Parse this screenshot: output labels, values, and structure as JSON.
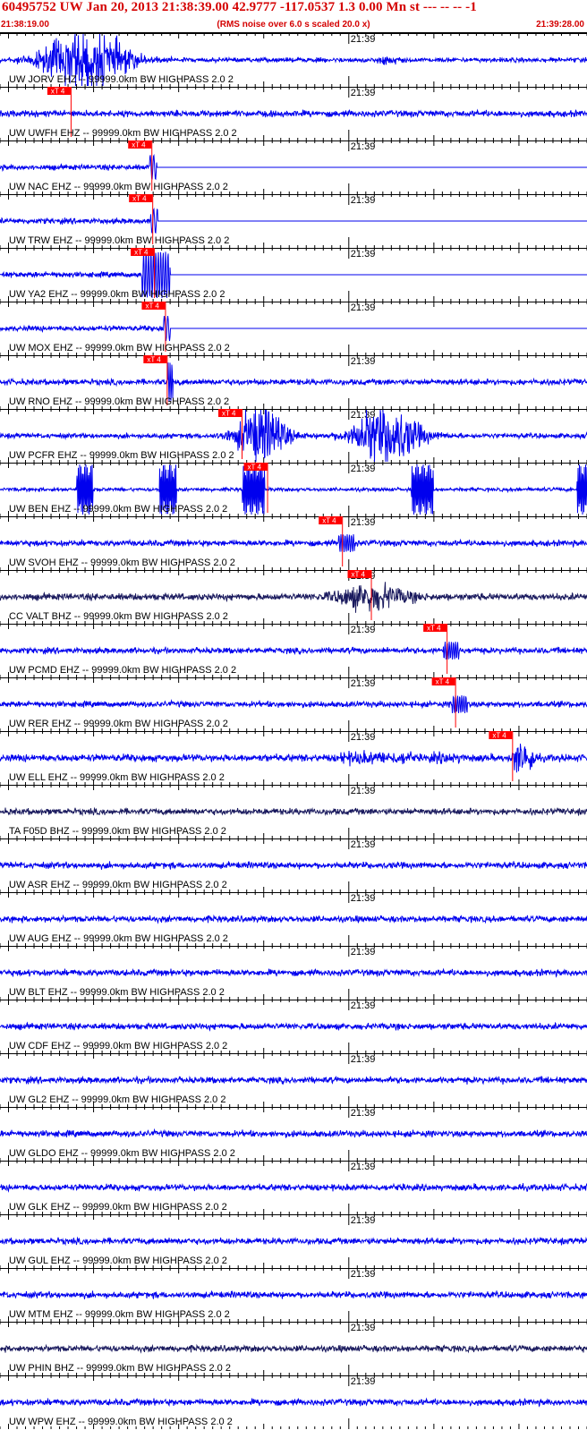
{
  "header": {
    "title": "60495752 UW Jan 20, 2013 21:38:39.00   42.9777 -117.0537  1.3 0.00 Mn st --- -- --  -1",
    "start_time": "21:38:19.00",
    "end_time": "21:39:28.00",
    "subtitle": "(RMS noise over 6.0 s scaled 20.0 x)"
  },
  "colors": {
    "trace": "#0000ee",
    "trace_dark": "#1a1a5e",
    "pick": "#ff0000",
    "title": "#d40000",
    "axis": "#000000"
  },
  "chart_data": {
    "type": "line",
    "title": "60495752 UW Jan 20, 2013 21:38:39.00   42.9777 -117.0537  1.3 0.00 Mn st --- -- --  -1",
    "xlabel": "",
    "ylabel": "",
    "time_range": [
      "21:38:19.00",
      "21:39:28.00"
    ],
    "minute_tick_label": "21:39",
    "minute_tick_time": "21:39:00",
    "grid": false,
    "traces": [
      {
        "label": "UW JORV EHZ -- 99999.0km BW  HIGHPASS  2.0  2",
        "pick": "",
        "pick_time": null,
        "shape": "early_burst",
        "color": "trace"
      },
      {
        "label": "UW UWFH EHZ -- 99999.0km BW  HIGHPASS  2.0  2",
        "pick": "xT 4",
        "pick_time": "21:38:27.3",
        "shape": "noise",
        "color": "trace"
      },
      {
        "label": "UW NAC EHZ -- 99999.0km BW  HIGHPASS  2.0  2",
        "pick": "xT 4",
        "pick_time": "21:38:36.8",
        "shape": "flat_after",
        "color": "trace"
      },
      {
        "label": "UW TRW EHZ -- 99999.0km BW  HIGHPASS  2.0  2",
        "pick": "xT 4",
        "pick_time": "21:38:36.9",
        "shape": "flat_after",
        "color": "trace"
      },
      {
        "label": "UW YA2 EHZ -- 99999.0km BW  HIGHPASS  2.0  2",
        "pick": "xT 4",
        "pick_time": "21:38:37.1",
        "shape": "flat_burst",
        "color": "trace"
      },
      {
        "label": "UW MOX EHZ -- 99999.0km BW  HIGHPASS  2.0  2",
        "pick": "xT 4",
        "pick_time": "21:38:38.4",
        "shape": "flat_after",
        "color": "trace"
      },
      {
        "label": "UW RNO EHZ -- 99999.0km BW  HIGHPASS  2.0  2",
        "pick": "xT 4",
        "pick_time": "21:38:38.6",
        "shape": "spike",
        "color": "trace"
      },
      {
        "label": "UW PCFR EHZ -- 99999.0km BW  HIGHPASS  2.0  2",
        "pick": "xT 4",
        "pick_time": "21:38:47.4",
        "shape": "two_bursts",
        "color": "trace"
      },
      {
        "label": "UW BEN EHZ -- 99999.0km BW  HIGHPASS  2.0  2",
        "pick": "xT 4",
        "pick_time": "21:38:50.4",
        "shape": "comb",
        "color": "trace"
      },
      {
        "label": "UW SVOH EHZ -- 99999.0km BW  HIGHPASS  2.0  2",
        "pick": "xT 4",
        "pick_time": "21:38:59.2",
        "shape": "small_event",
        "color": "trace"
      },
      {
        "label": "CC VALT BHZ -- 99999.0km BW  HIGHPASS  2.0  2",
        "pick": "xT 4",
        "pick_time": "21:39:02.6",
        "shape": "dark_burst",
        "color": "trace_dark"
      },
      {
        "label": "UW PCMD EHZ -- 99999.0km BW  HIGHPASS  2.0  2",
        "pick": "xT 4",
        "pick_time": "21:39:11.5",
        "shape": "small_event",
        "color": "trace"
      },
      {
        "label": "UW RER EHZ -- 99999.0km BW  HIGHPASS  2.0  2",
        "pick": "xT 4",
        "pick_time": "21:39:12.5",
        "shape": "small_event",
        "color": "trace"
      },
      {
        "label": "UW ELL EHZ -- 99999.0km BW  HIGHPASS  2.0  2",
        "pick": "xT 4",
        "pick_time": "21:39:19.2",
        "shape": "late_event",
        "color": "trace"
      },
      {
        "label": "TA F05D BHZ -- 99999.0km BW  HIGHPASS  2.0  2",
        "pick": "",
        "pick_time": null,
        "shape": "noise",
        "color": "trace_dark"
      },
      {
        "label": "UW ASR EHZ -- 99999.0km BW  HIGHPASS  2.0  2",
        "pick": "",
        "pick_time": null,
        "shape": "noise",
        "color": "trace"
      },
      {
        "label": "UW AUG EHZ -- 99999.0km BW  HIGHPASS  2.0  2",
        "pick": "",
        "pick_time": null,
        "shape": "noise",
        "color": "trace"
      },
      {
        "label": "UW BLT EHZ -- 99999.0km BW  HIGHPASS  2.0  2",
        "pick": "",
        "pick_time": null,
        "shape": "noise",
        "color": "trace"
      },
      {
        "label": "UW CDF EHZ -- 99999.0km BW  HIGHPASS  2.0  2",
        "pick": "",
        "pick_time": null,
        "shape": "noise",
        "color": "trace"
      },
      {
        "label": "UW GL2 EHZ -- 99999.0km BW  HIGHPASS  2.0  2",
        "pick": "",
        "pick_time": null,
        "shape": "noise",
        "color": "trace"
      },
      {
        "label": "UW GLDO EHZ -- 99999.0km BW  HIGHPASS  2.0  2",
        "pick": "",
        "pick_time": null,
        "shape": "noise",
        "color": "trace"
      },
      {
        "label": "UW GLK EHZ -- 99999.0km BW  HIGHPASS  2.0  2",
        "pick": "",
        "pick_time": null,
        "shape": "noise",
        "color": "trace"
      },
      {
        "label": "UW GUL EHZ -- 99999.0km BW  HIGHPASS  2.0  2",
        "pick": "",
        "pick_time": null,
        "shape": "noise",
        "color": "trace"
      },
      {
        "label": "UW MTM EHZ -- 99999.0km BW  HIGHPASS  2.0  2",
        "pick": "",
        "pick_time": null,
        "shape": "noise",
        "color": "trace"
      },
      {
        "label": "UW PHIN BHZ -- 99999.0km BW  HIGHPASS  2.0  2",
        "pick": "",
        "pick_time": null,
        "shape": "noise",
        "color": "trace_dark"
      },
      {
        "label": "UW WPW EHZ -- 99999.0km BW  HIGHPASS  2.0  2",
        "pick": "",
        "pick_time": null,
        "shape": "noise",
        "color": "trace"
      }
    ]
  }
}
